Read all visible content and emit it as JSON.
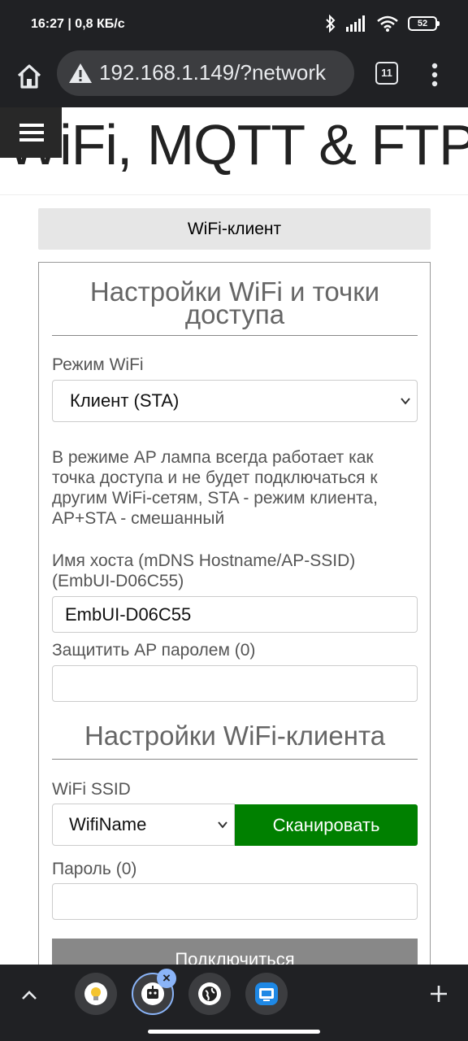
{
  "status": {
    "time_speed": "16:27 | 0,8 КБ/с",
    "battery": "52"
  },
  "browser": {
    "url": "192.168.1.149/?network",
    "tab_count": "11"
  },
  "header": {
    "title": "WiFi, MQTT & FTP"
  },
  "page": {
    "tab_label": "WiFi-клиент",
    "section1_title": "Настройки WiFi и точки доступа",
    "wifi_mode_label": "Режим WiFi",
    "wifi_mode_value": "Клиент (STA)",
    "wifi_mode_desc": "В режиме AP лампа всегда работает как точка доступа и не будет подключаться к другим WiFi-сетям, STA - режим клиента, AP+STA - смешанный",
    "hostname_label": "Имя хоста (mDNS Hostname/AP-SSID) (EmbUI-D06C55)",
    "hostname_value": "EmbUI-D06C55",
    "ap_password_label": "Защитить AP паролем (0)",
    "ap_password_value": "",
    "section2_title": "Настройки WiFi-клиента",
    "ssid_label": "WiFi SSID",
    "ssid_value": "WifiName",
    "scan_button": "Сканировать",
    "password_label": "Пароль (0)",
    "password_value": "",
    "connect_button": "Подключиться"
  },
  "colors": {
    "scan_button": "#008000",
    "connect_button": "#888888",
    "chrome_bg": "#202124"
  },
  "bottom_tabs": [
    {
      "icon": "lightbulb-icon"
    },
    {
      "icon": "robot-icon",
      "active": true
    },
    {
      "icon": "globe-icon"
    },
    {
      "icon": "router-icon"
    }
  ]
}
